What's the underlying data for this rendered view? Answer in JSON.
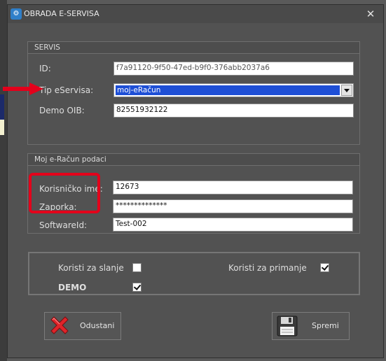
{
  "window": {
    "title": "OBRADA E-SERVISA"
  },
  "servis": {
    "title": "SERVIS",
    "id_label": "ID:",
    "id_value": "f7a91120-9f50-47ed-b9f0-376abb2037a6",
    "tip_label": "Tip eServisa:",
    "tip_value": "moj-eRačun",
    "oib_label": "Demo OIB:",
    "oib_value": "82551932122"
  },
  "moj": {
    "title": "Moj e-Račun podaci",
    "user_label": "Korisničko ime:",
    "user_value": "12673",
    "pass_label": "Zaporka:",
    "pass_value": "**************",
    "software_label": "SoftwareId:",
    "software_value": "Test-002"
  },
  "options": {
    "slanje_label": "Koristi za slanje",
    "slanje_checked": false,
    "primanje_label": "Koristi za primanje",
    "primanje_checked": true,
    "demo_label": "DEMO",
    "demo_checked": true
  },
  "buttons": {
    "cancel_label": "Odustani",
    "save_label": "Spremi"
  },
  "colors": {
    "annotation": "#e3001b",
    "selection": "#1e4fd6"
  },
  "icons": {
    "app": "e-servis-app-icon",
    "cancel": "red-x-icon",
    "save": "floppy-disk-icon",
    "close": "close-icon"
  }
}
